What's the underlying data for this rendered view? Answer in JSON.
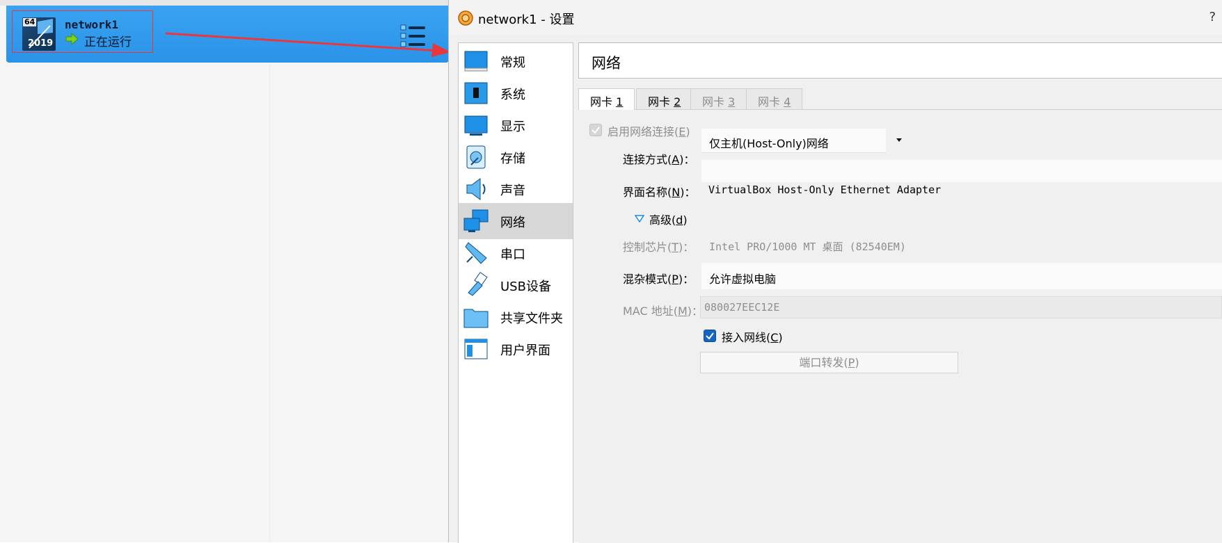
{
  "vm_manager": {
    "vm": {
      "name": "network1",
      "status": "正在运行",
      "os_icon": {
        "bits": "64",
        "year": "2019"
      },
      "status_icon": "running-arrow-icon"
    },
    "menu_icon": "list-menu-icon"
  },
  "dialog": {
    "title": "network1 - 设置",
    "help": "?",
    "sidebar": {
      "items": [
        {
          "label": "常规",
          "icon": "general-icon"
        },
        {
          "label": "系统",
          "icon": "system-icon"
        },
        {
          "label": "显示",
          "icon": "display-icon"
        },
        {
          "label": "存储",
          "icon": "storage-icon"
        },
        {
          "label": "声音",
          "icon": "audio-icon"
        },
        {
          "label": "网络",
          "icon": "network-icon",
          "selected": true
        },
        {
          "label": "串口",
          "icon": "serial-port-icon"
        },
        {
          "label": "USB设备",
          "icon": "usb-icon"
        },
        {
          "label": "共享文件夹",
          "icon": "shared-folder-icon"
        },
        {
          "label": "用户界面",
          "icon": "user-interface-icon"
        }
      ]
    },
    "panel": {
      "title": "网络",
      "tabs": [
        {
          "label": "网卡 ",
          "num": "1",
          "active": true
        },
        {
          "label": "网卡 ",
          "num": "2"
        },
        {
          "label": "网卡 ",
          "num": "3"
        },
        {
          "label": "网卡 ",
          "num": "4"
        }
      ],
      "enable_adapter": {
        "label": "启用网络连接(",
        "key": "E",
        "end": ")",
        "checked": true,
        "enabled": false
      },
      "attached_to": {
        "label": "连接方式(",
        "key": "A",
        "end": ")：",
        "value": "仅主机(Host-Only)网络"
      },
      "name": {
        "label": "界面名称(",
        "key": "N",
        "end": ")：",
        "value": "VirtualBox Host-Only Ethernet Adapter"
      },
      "advanced": {
        "label": "高级(",
        "key": "d",
        "end": ")"
      },
      "adapter_type": {
        "label": "控制芯片(",
        "key": "T",
        "end": ")：",
        "value": "Intel PRO/1000 MT 桌面 (82540EM)"
      },
      "promiscuous": {
        "label": "混杂模式(",
        "key": "P",
        "end": ")：",
        "value": "允许虚拟电脑"
      },
      "mac": {
        "label": "MAC 地址(",
        "key": "M",
        "end": ")：",
        "value": "080027EEC12E"
      },
      "cable_connected": {
        "label": "接入网线(",
        "key": "C",
        "end": ")",
        "checked": true
      },
      "port_forwarding": {
        "label": "端口转发(",
        "key": "P",
        "end": ")"
      }
    }
  },
  "colors": {
    "vm_item": "#2f98eb",
    "annotation": "#e8383d",
    "checkbox": "#1565c0"
  }
}
